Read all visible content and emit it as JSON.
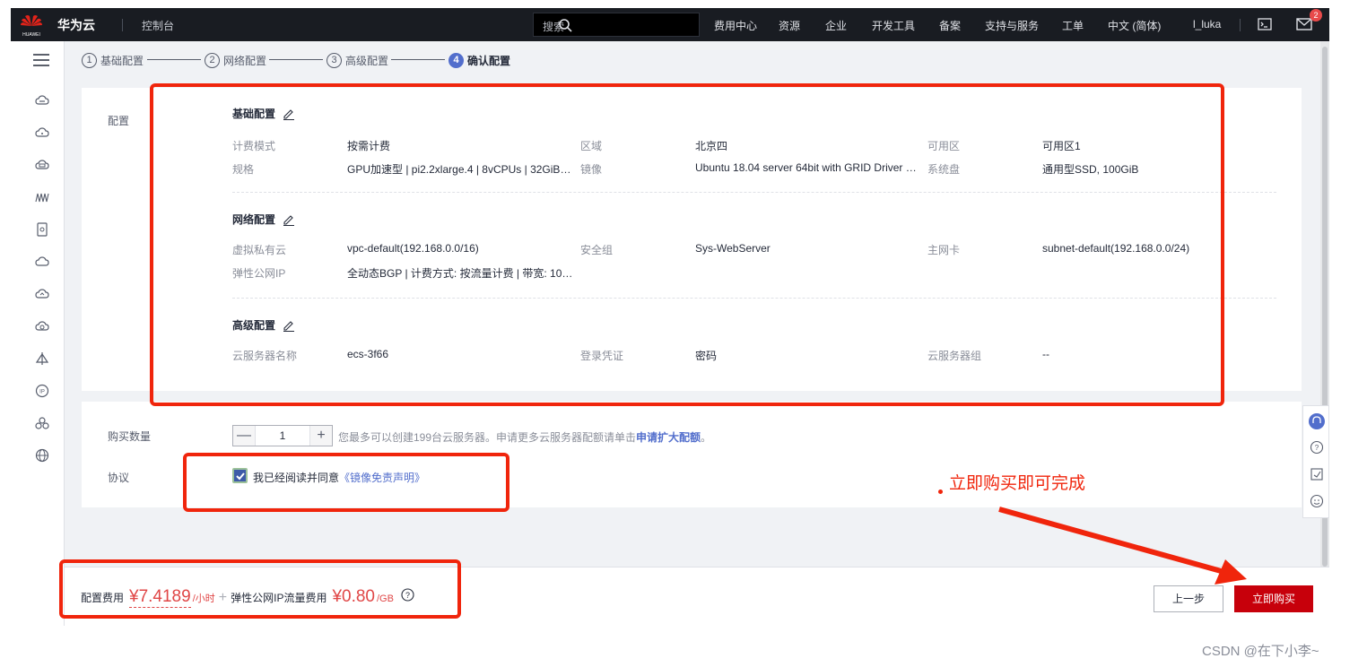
{
  "topbar": {
    "brand": "华为云",
    "logo_text": "HUAWEI",
    "console": "控制台",
    "search_placeholder": "搜索",
    "nav": [
      "费用中心",
      "资源",
      "企业",
      "开发工具",
      "备案",
      "支持与服务",
      "工单",
      "中文 (简体)",
      "l_luka"
    ],
    "badge": "2"
  },
  "steps": [
    {
      "num": "1",
      "label": "基础配置"
    },
    {
      "num": "2",
      "label": "网络配置"
    },
    {
      "num": "3",
      "label": "高级配置"
    },
    {
      "num": "4",
      "label": "确认配置"
    }
  ],
  "config": {
    "section_label": "配置",
    "basic": {
      "title": "基础配置",
      "rows": [
        {
          "k1": "计费模式",
          "v1": "按需计费",
          "k2": "区域",
          "v2": "北京四",
          "k3": "可用区",
          "v3": "可用区1"
        },
        {
          "k1": "规格",
          "v1": "GPU加速型 | pi2.2xlarge.4 | 8vCPUs | 32GiB | G...",
          "k2": "镜像",
          "v2": "Ubuntu 18.04 server 64bit with GRID Driver 11.1",
          "k3": "系统盘",
          "v3": "通用型SSD, 100GiB"
        }
      ]
    },
    "network": {
      "title": "网络配置",
      "rows": [
        {
          "k1": "虚拟私有云",
          "v1": "vpc-default(192.168.0.0/16)",
          "k2": "安全组",
          "v2": "Sys-WebServer",
          "k3": "主网卡",
          "v3": "subnet-default(192.168.0.0/24)"
        },
        {
          "k1": "弹性公网IP",
          "v1": "全动态BGP | 计费方式: 按流量计费 | 带宽: 100 M..."
        }
      ]
    },
    "advanced": {
      "title": "高级配置",
      "rows": [
        {
          "k1": "云服务器名称",
          "v1": "ecs-3f66",
          "k2": "登录凭证",
          "v2": "密码",
          "k3": "云服务器组",
          "v3": "--"
        }
      ]
    }
  },
  "purchase": {
    "qty_label": "购买数量",
    "minus": "—",
    "qty": "1",
    "plus": "+",
    "hint": "您最多可以创建199台云服务器。申请更多云服务器配额请单击",
    "hint_link": "申请扩大配额",
    "hint_end": "。",
    "agreement_label": "协议",
    "agree_text": "我已经阅读并同意",
    "agree_link": "《镜像免责声明》"
  },
  "footer": {
    "fee_label": "配置费用",
    "fee_value": "¥7.4189",
    "fee_unit": "/小时",
    "plus": "+",
    "ip_label": "弹性公网IP流量费用",
    "ip_value": "¥0.80",
    "ip_unit": "/GB",
    "prev": "上一步",
    "buy": "立即购买"
  },
  "annotation": "立即购买即可完成",
  "watermark": "CSDN @在下小李~",
  "colors": {
    "topbar": "#191c22",
    "accent": "#526ecc",
    "buy": "#c7000b",
    "annotation": "#f0250c",
    "price": "#e04646"
  }
}
